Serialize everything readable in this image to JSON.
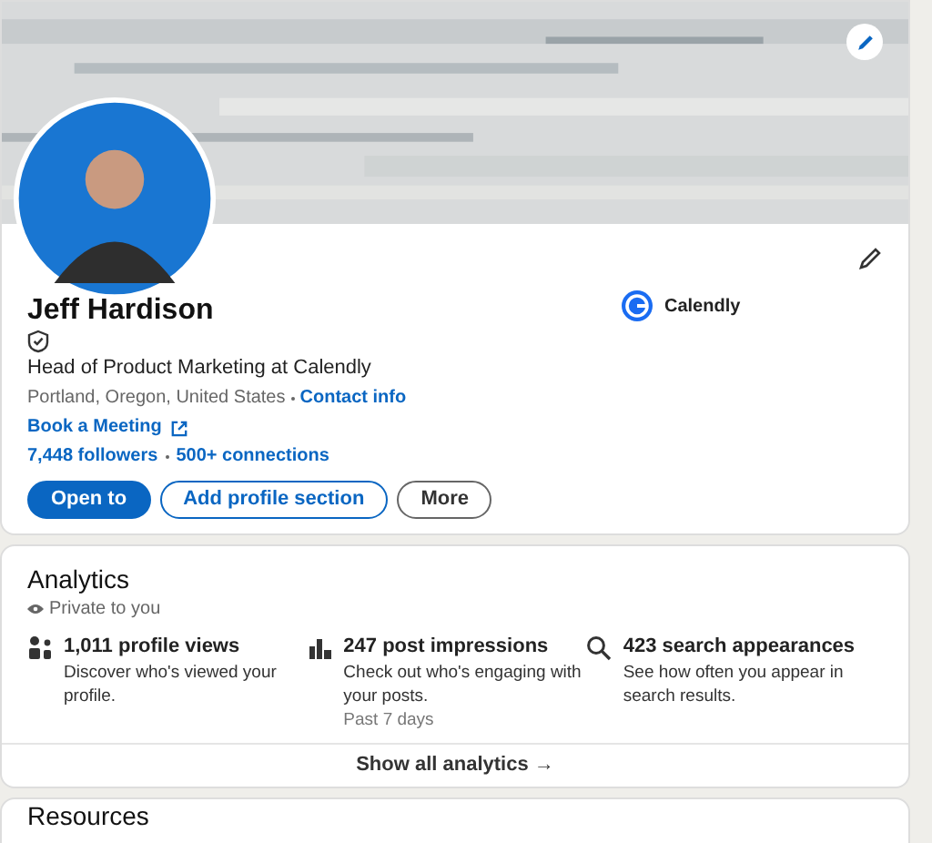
{
  "profile": {
    "name": "Jeff Hardison",
    "headline": "Head of Product Marketing at Calendly",
    "location": "Portland, Oregon, United States",
    "contact_link": "Contact info",
    "website_link": "Book a Meeting",
    "followers": "7,448 followers",
    "connections": "500+ connections",
    "company": "Calendly",
    "buttons": [
      {
        "label": "Open to",
        "kind": "primary"
      },
      {
        "label": "Add profile section",
        "kind": "outline"
      },
      {
        "label": "More",
        "kind": "secondary"
      }
    ]
  },
  "analytics": {
    "title": "Analytics",
    "privacy": "Private to you",
    "items": [
      {
        "kind": "people",
        "title": "1,011 profile views",
        "description": "Discover who's viewed your profile."
      },
      {
        "kind": "chart",
        "title": "247 post impressions",
        "description": "Check out who's engaging with your posts.",
        "note": "Past 7 days"
      },
      {
        "kind": "search",
        "title": "423 search appearances",
        "description": "See how often you appear in search results."
      }
    ],
    "show_all": "Show all analytics →"
  },
  "next_section": {
    "title": "Resources"
  }
}
